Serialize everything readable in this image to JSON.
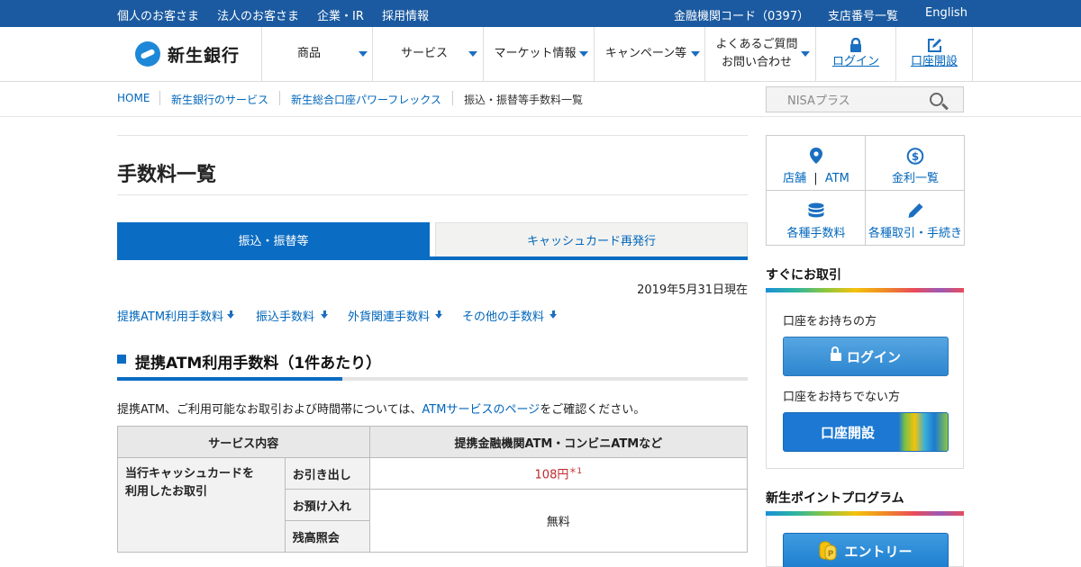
{
  "topbar": {
    "left_links": [
      "個人のお客さま",
      "法人のお客さま",
      "企業・IR",
      "採用情報"
    ],
    "bank_code": "金融機関コード（0397）",
    "branch_list": "支店番号一覧",
    "english": "English"
  },
  "header": {
    "logo_text": "新生銀行",
    "nav": {
      "products": "商品",
      "services": "サービス",
      "market": "マーケット情報",
      "campaign": "キャンペーン等",
      "faq_line1": "よくあるご質問",
      "faq_line2": "お問い合わせ",
      "login": "ログイン",
      "open_account": "口座開設"
    }
  },
  "breadcrumb": [
    "HOME",
    "新生銀行のサービス",
    "新生総合口座パワーフレックス",
    "振込・振替等手数料一覧"
  ],
  "search": {
    "placeholder": "NISAプラス"
  },
  "main": {
    "title": "手数料一覧",
    "tabs": [
      "振込・振替等",
      "キャッシュカード再発行"
    ],
    "date": "2019年5月31日現在",
    "anchors": [
      "提携ATM利用手数料",
      "振込手数料",
      "外貨関連手数料",
      "その他の手数料"
    ],
    "section_title": "提携ATM利用手数料（1件あたり）",
    "intro_before": "提携ATM、ご利用可能なお取引および時間帯については、",
    "intro_link": "ATMサービスのページ",
    "intro_after": "をご確認ください。",
    "table": {
      "headers": [
        "サービス内容",
        "提携金融機関ATM・コンビニATMなど"
      ],
      "row_head_line1": "当行キャッシュカードを",
      "row_head_line2": "利用したお取引",
      "sub_rows": [
        "お引き出し",
        "お預け入れ",
        "残高照会"
      ],
      "withdraw_fee": "108円",
      "withdraw_note": "＊1",
      "free": "無料"
    }
  },
  "sidebar": {
    "quick_links": {
      "store": "店舗",
      "sep": "|",
      "atm": "ATM",
      "rates": "金利一覧",
      "fees": "各種手数料",
      "procedures": "各種取引・手続き"
    },
    "instant": {
      "heading": "すぐにお取引",
      "have_account": "口座をお持ちの方",
      "login_btn": "ログイン",
      "no_account": "口座をお持ちでない方",
      "open_btn": "口座開設"
    },
    "points": {
      "heading": "新生ポイントプログラム",
      "entry_btn": "エントリー"
    }
  },
  "colors": {
    "brand_blue": "#0a6cc2",
    "topbar_blue": "#1b5aa0",
    "fee_red": "#c0272d"
  }
}
